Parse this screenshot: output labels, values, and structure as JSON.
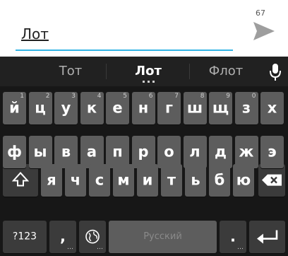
{
  "compose": {
    "text": "Лот",
    "char_count": "67"
  },
  "suggestions": [
    "Тот",
    "Лот",
    "Флот"
  ],
  "row1": [
    {
      "l": "й",
      "n": "1"
    },
    {
      "l": "ц",
      "n": "2"
    },
    {
      "l": "у",
      "n": "3"
    },
    {
      "l": "к",
      "n": "4"
    },
    {
      "l": "е",
      "n": "5"
    },
    {
      "l": "н",
      "n": "6"
    },
    {
      "l": "г",
      "n": "7"
    },
    {
      "l": "ш",
      "n": "8"
    },
    {
      "l": "щ",
      "n": "9"
    },
    {
      "l": "з",
      "n": "0"
    },
    {
      "l": "х",
      "n": ""
    }
  ],
  "row2": [
    "ф",
    "ы",
    "в",
    "а",
    "п",
    "р",
    "о",
    "л",
    "д",
    "ж",
    "э"
  ],
  "row3": [
    "я",
    "ч",
    "с",
    "м",
    "и",
    "т",
    "ь",
    "б",
    "ю"
  ],
  "bottom": {
    "symbols": "?123",
    "comma": ",",
    "space": "Русский",
    "period": "."
  },
  "icons": {
    "send": "send-arrow-icon",
    "mic": "microphone-icon",
    "shift": "shift-arrow-icon",
    "backspace": "backspace-icon",
    "language": "globe-icon",
    "enter": "enter-arrow-icon"
  },
  "colors": {
    "accent": "#33b5e5",
    "keyboard_bg": "#171717",
    "key_bg": "#5d5d5d"
  }
}
